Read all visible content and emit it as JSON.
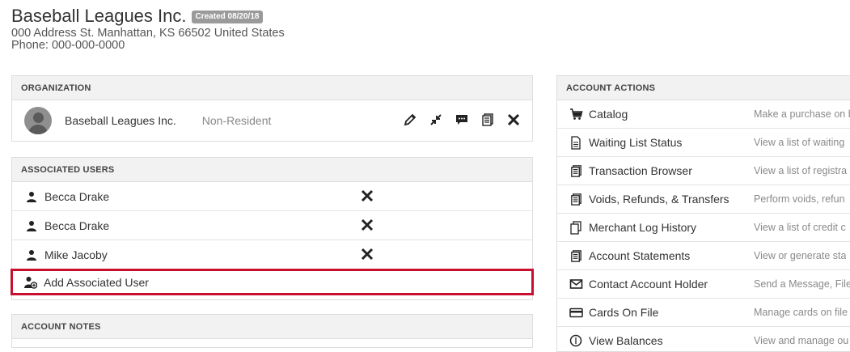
{
  "account": {
    "name": "Baseball Leagues Inc.",
    "created_badge": "Created 08/20/18",
    "address": "000 Address St. Manhattan, KS 66502 United States",
    "phone": "Phone: 000-000-0000"
  },
  "organization": {
    "heading": "ORGANIZATION",
    "name": "Baseball Leagues Inc.",
    "status": "Non-Resident",
    "actions": [
      "pencil-icon",
      "collapse-icon",
      "comment-icon",
      "receipts-icon",
      "close-icon"
    ]
  },
  "associated_users": {
    "heading": "ASSOCIATED USERS",
    "users": [
      {
        "name": "Becca Drake"
      },
      {
        "name": "Becca Drake"
      },
      {
        "name": "Mike Jacoby"
      }
    ],
    "add_label": "Add Associated User",
    "highlight_color": "#c8102e"
  },
  "account_notes": {
    "heading": "ACCOUNT NOTES"
  },
  "account_actions": {
    "heading": "ACCOUNT ACTIONS",
    "items": [
      {
        "label": "Catalog",
        "desc": "Make a purchase on b",
        "icon": "cart-icon"
      },
      {
        "label": "Waiting List Status",
        "desc": "View a list of waiting",
        "icon": "document-icon"
      },
      {
        "label": "Transaction Browser",
        "desc": "View a list of registra",
        "icon": "receipts-icon"
      },
      {
        "label": "Voids, Refunds, & Transfers",
        "desc": "Perform voids, refun",
        "icon": "receipts-icon"
      },
      {
        "label": "Merchant Log History",
        "desc": "View a list of credit c",
        "icon": "copy-icon"
      },
      {
        "label": "Account Statements",
        "desc": "View or generate sta",
        "icon": "receipts-icon"
      },
      {
        "label": "Contact Account Holder",
        "desc": "Send a Message, File",
        "icon": "envelope-icon"
      },
      {
        "label": "Cards On File",
        "desc": "Manage cards on file",
        "icon": "credit-card-icon"
      },
      {
        "label": "View Balances",
        "desc": "View and manage ou",
        "icon": "money-icon"
      }
    ]
  }
}
